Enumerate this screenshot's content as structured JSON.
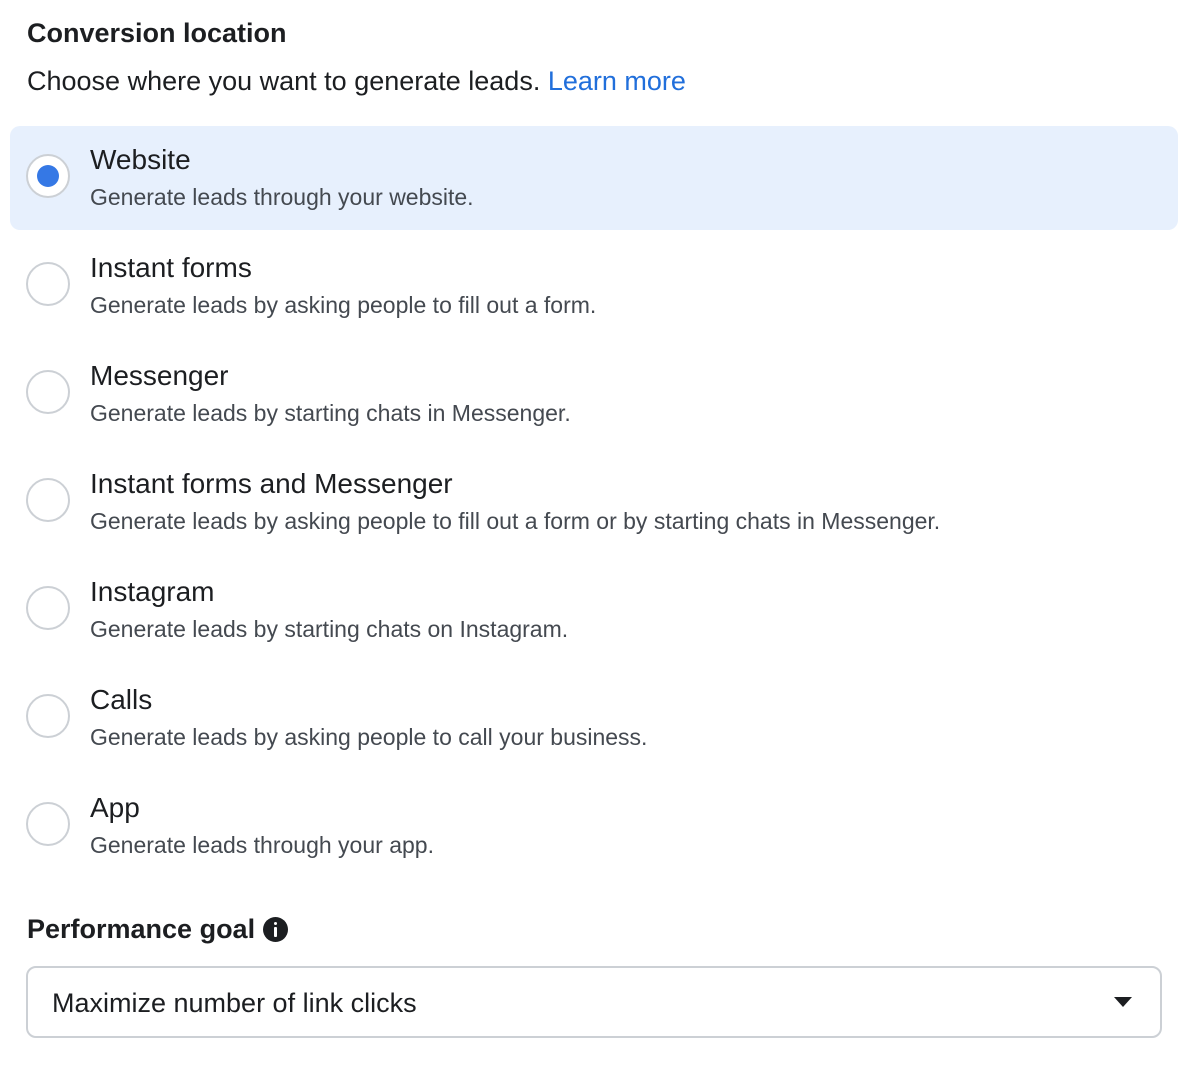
{
  "conversion_location": {
    "title": "Conversion location",
    "subtitle": "Choose where you want to generate leads.",
    "learn_more": "Learn more",
    "selected_index": 0,
    "options": [
      {
        "label": "Website",
        "description": "Generate leads through your website.",
        "selected": true
      },
      {
        "label": "Instant forms",
        "description": "Generate leads by asking people to fill out a form.",
        "selected": false
      },
      {
        "label": "Messenger",
        "description": "Generate leads by starting chats in Messenger.",
        "selected": false
      },
      {
        "label": "Instant forms and Messenger",
        "description": "Generate leads by asking people to fill out a form or by starting chats in Messenger.",
        "selected": false
      },
      {
        "label": "Instagram",
        "description": "Generate leads by starting chats on Instagram.",
        "selected": false
      },
      {
        "label": "Calls",
        "description": "Generate leads by asking people to call your business.",
        "selected": false
      },
      {
        "label": "App",
        "description": "Generate leads through your app.",
        "selected": false
      }
    ]
  },
  "performance_goal": {
    "title": "Performance goal",
    "info_icon": "info-icon",
    "selected_value": "Maximize number of link clicks",
    "dropdown_icon": "chevron-down-icon"
  },
  "colors": {
    "accent": "#3578e5",
    "link": "#216fdb",
    "selected_bg": "#e7f0fd",
    "border": "#ccd0d5"
  }
}
